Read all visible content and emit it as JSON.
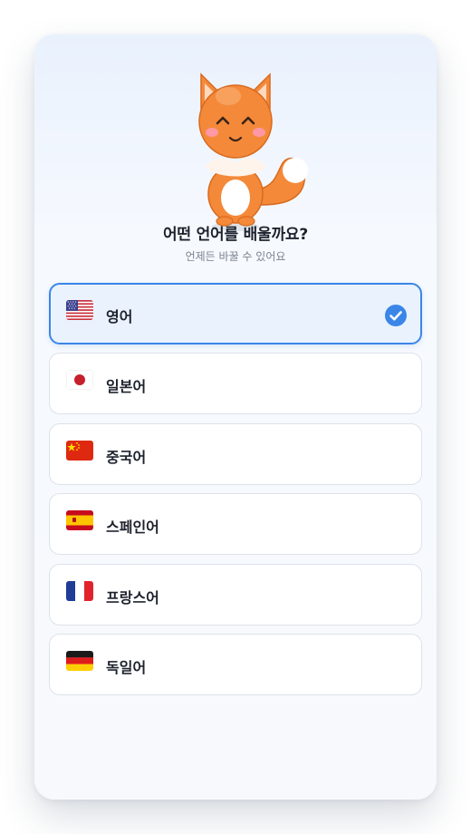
{
  "screen": {
    "title": "어떤 언어를 배울까요?",
    "subtitle": "언제든 바꿀 수 있어요"
  },
  "mascot": {
    "icon": "fox-mascot-icon"
  },
  "languages": [
    {
      "label": "영어",
      "flag": "us-flag-icon",
      "selected": true
    },
    {
      "label": "일본어",
      "flag": "japan-flag-icon",
      "selected": false
    },
    {
      "label": "중국어",
      "flag": "china-flag-icon",
      "selected": false
    },
    {
      "label": "스페인어",
      "flag": "spain-flag-icon",
      "selected": false
    },
    {
      "label": "프랑스어",
      "flag": "france-flag-icon",
      "selected": false
    },
    {
      "label": "독일어",
      "flag": "germany-flag-icon",
      "selected": false
    }
  ],
  "colors": {
    "accent": "#3a86e8",
    "selected_bg": "#eaf2fe",
    "mascot_orange": "#f4893a"
  }
}
